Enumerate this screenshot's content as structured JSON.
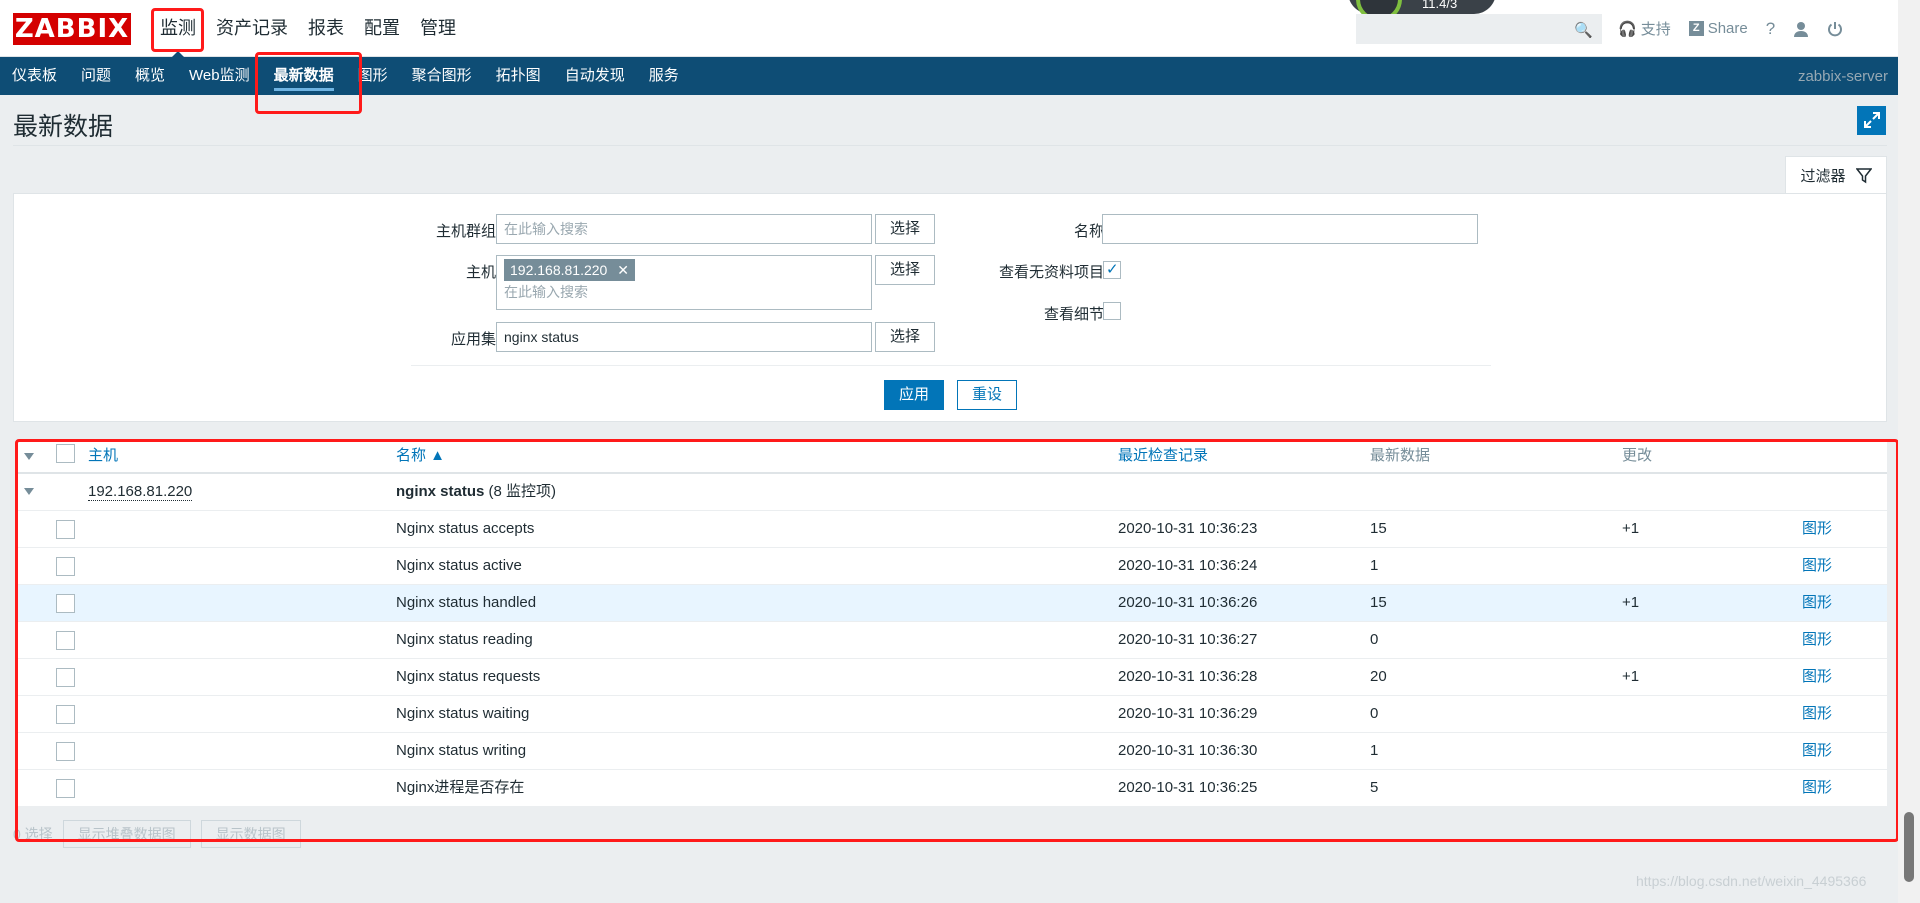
{
  "header": {
    "logo": "ZABBIX",
    "menu": [
      "监测",
      "资产记录",
      "报表",
      "配置",
      "管理"
    ],
    "gauge_text": "11.4/3",
    "links": [
      "支持",
      "Share",
      "?"
    ]
  },
  "subnav": {
    "items": [
      "仪表板",
      "问题",
      "概览",
      "Web监测",
      "最新数据",
      "图形",
      "聚合图形",
      "拓扑图",
      "自动发现",
      "服务"
    ],
    "server": "zabbix-server"
  },
  "page": {
    "title": "最新数据",
    "filter_tab": "过滤器"
  },
  "filter": {
    "host_group_label": "主机群组",
    "host_group_placeholder": "在此输入搜索",
    "host_label": "主机",
    "host_chip": "192.168.81.220",
    "host_placeholder": "在此输入搜索",
    "app_label": "应用集",
    "app_value": "nginx status",
    "select_label": "选择",
    "name_label": "名称",
    "name_value": "",
    "show_without_data_label": "查看无资料项目",
    "show_without_data": true,
    "show_details_label": "查看细节",
    "show_details": false,
    "apply": "应用",
    "reset": "重设"
  },
  "table": {
    "headers": {
      "host": "主机",
      "name": "名称 ▲",
      "last_check": "最近检查记录",
      "last_value": "最新数据",
      "change": "更改"
    },
    "group": {
      "host": "192.168.81.220",
      "app": "nginx status",
      "count": "(8 监控项)"
    },
    "rows": [
      {
        "name": "Nginx status accepts",
        "last_check": "2020-10-31 10:36:23",
        "last_value": "15",
        "change": "+1",
        "action": "图形"
      },
      {
        "name": "Nginx status active",
        "last_check": "2020-10-31 10:36:24",
        "last_value": "1",
        "change": "",
        "action": "图形"
      },
      {
        "name": "Nginx status handled",
        "last_check": "2020-10-31 10:36:26",
        "last_value": "15",
        "change": "+1",
        "action": "图形"
      },
      {
        "name": "Nginx status reading",
        "last_check": "2020-10-31 10:36:27",
        "last_value": "0",
        "change": "",
        "action": "图形"
      },
      {
        "name": "Nginx status requests",
        "last_check": "2020-10-31 10:36:28",
        "last_value": "20",
        "change": "+1",
        "action": "图形"
      },
      {
        "name": "Nginx status waiting",
        "last_check": "2020-10-31 10:36:29",
        "last_value": "0",
        "change": "",
        "action": "图形"
      },
      {
        "name": "Nginx status writing",
        "last_check": "2020-10-31 10:36:30",
        "last_value": "1",
        "change": "",
        "action": "图形"
      },
      {
        "name": "Nginx进程是否存在",
        "last_check": "2020-10-31 10:36:25",
        "last_value": "5",
        "change": "",
        "action": "图形"
      }
    ]
  },
  "footer": {
    "selected": "0 选择",
    "btn_stacked": "显示堆叠数据图",
    "btn_graph": "显示数据图"
  },
  "watermark": "https://blog.csdn.net/weixin_4495366"
}
